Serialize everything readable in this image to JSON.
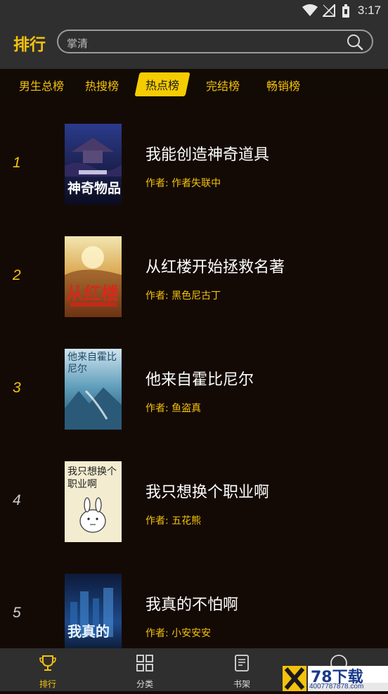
{
  "status": {
    "time": "3:17"
  },
  "header": {
    "title": "排行",
    "search_value": "掌清"
  },
  "tabs": [
    "男生总榜",
    "热搜榜",
    "热点榜",
    "完结榜",
    "畅销榜"
  ],
  "active_tab": "热点榜",
  "books": [
    {
      "rank": "1",
      "title": "我能创造神奇道具",
      "author": "作者: 作者失联中",
      "cover_text": "神奇物品"
    },
    {
      "rank": "2",
      "title": "从红楼开始拯救名著",
      "author": "作者: 黑色尼古丁",
      "cover_text": "从红楼"
    },
    {
      "rank": "3",
      "title": "他来自霍比尼尔",
      "author": "作者: 鱼盗真",
      "cover_text": "他来自霍比尼尔"
    },
    {
      "rank": "4",
      "title": "我只想换个职业啊",
      "author": "作者: 五花熊",
      "cover_text": "我只想换个职业啊"
    },
    {
      "rank": "5",
      "title": "我真的不怕啊",
      "author": "作者: 小安安安",
      "cover_text": "我真的"
    }
  ],
  "bottom_nav": [
    "排行",
    "分类",
    "书架",
    ""
  ],
  "watermark": {
    "brand": "78下载",
    "site": "4007787878.com"
  },
  "colors": {
    "accent": "#f4c20d",
    "background": "#140a05",
    "bar": "#2f2f2f"
  }
}
